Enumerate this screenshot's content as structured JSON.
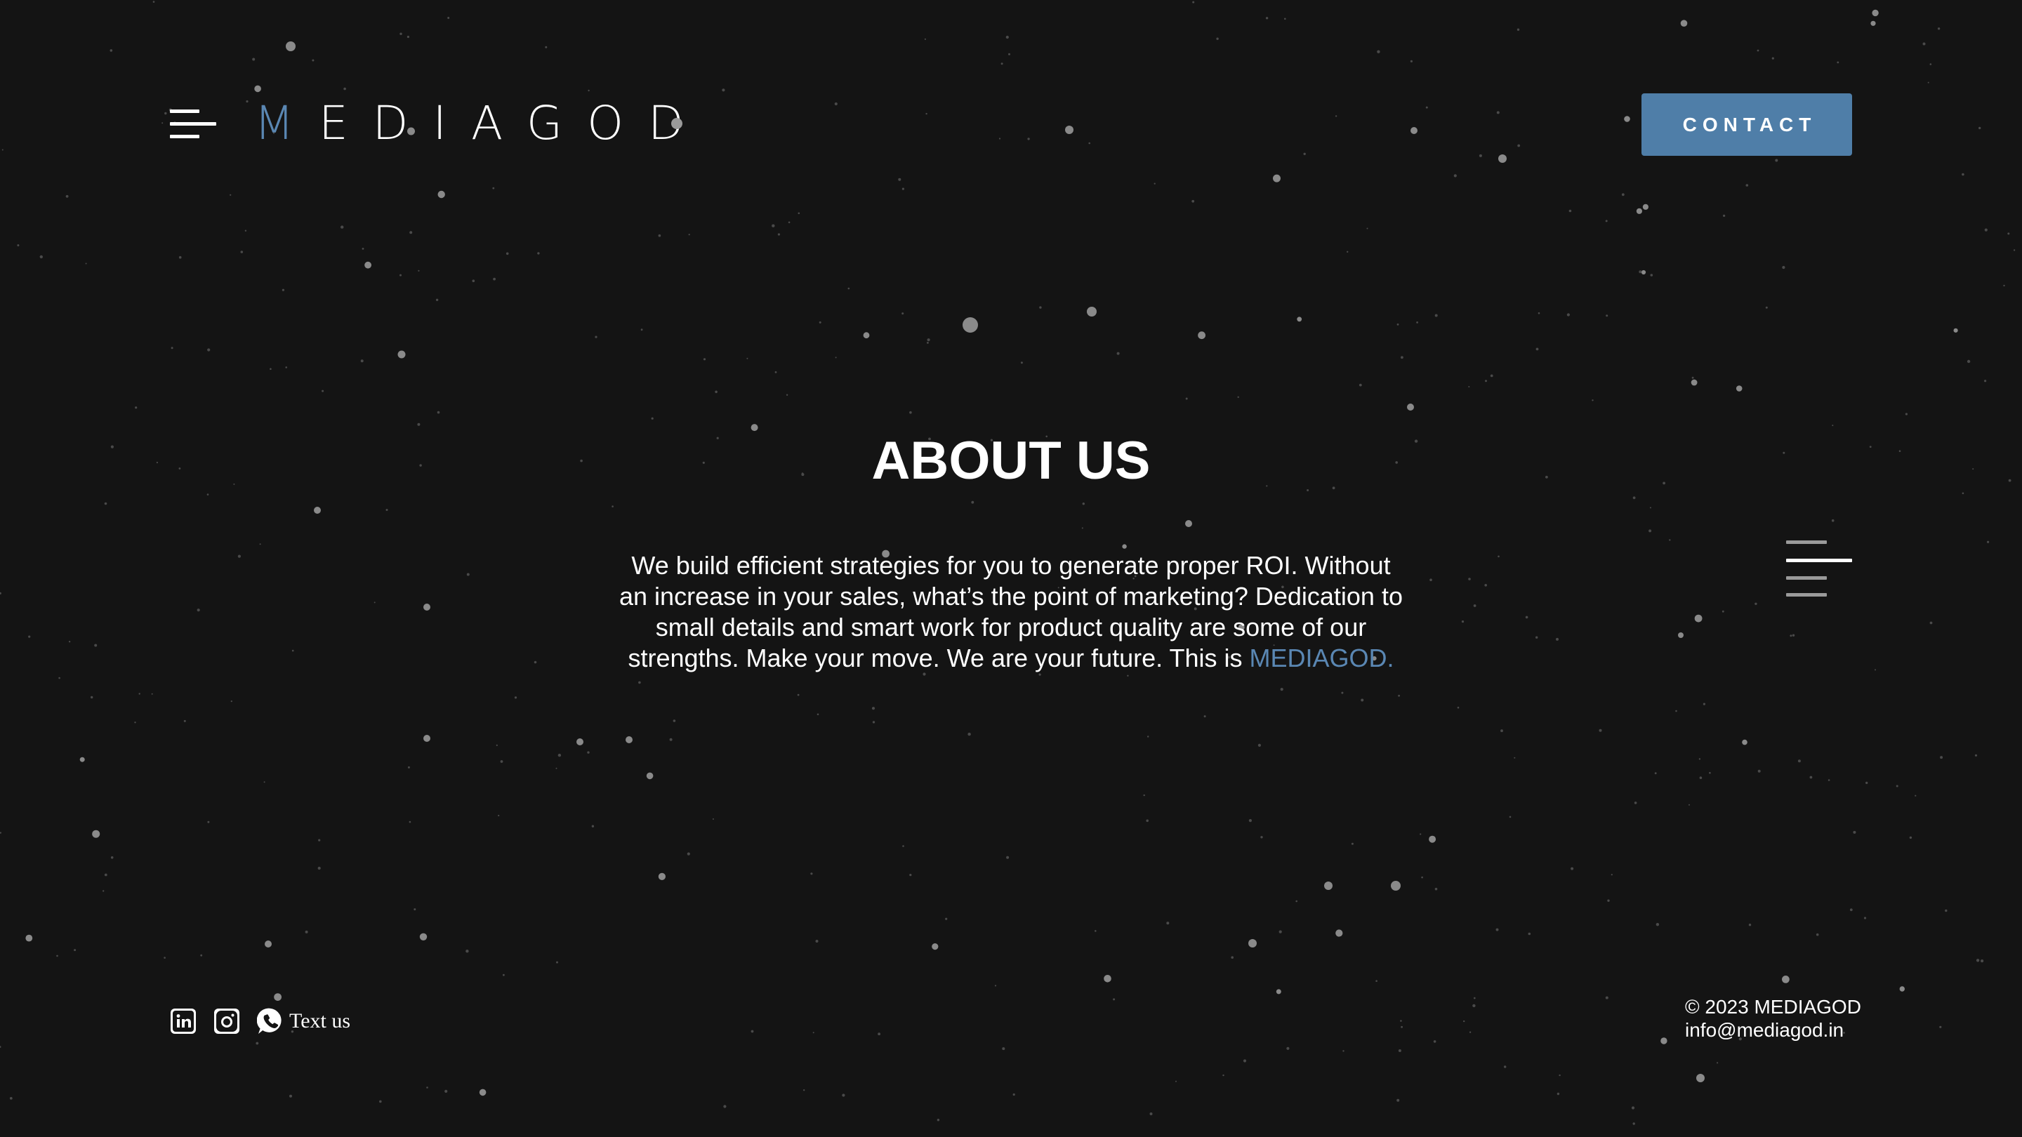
{
  "header": {
    "logo_first_letter": "M",
    "logo_rest": "EDIAGOD",
    "contact_label": "CONTACT"
  },
  "about": {
    "title": "ABOUT US",
    "body": "We build efficient strategies for you to generate proper ROI. Without an increase in your sales, what’s the point of marketing? Dedication to small details and smart work for product quality are some of our strengths. Make your move. We are your future. This is ",
    "brand": "MEDIAGOD."
  },
  "footer": {
    "social": [
      {
        "icon": "linkedin-icon"
      },
      {
        "icon": "instagram-icon"
      },
      {
        "icon": "whatsapp-icon",
        "label": "Text us"
      }
    ],
    "copyright": "© 2023 MEDIAGOD",
    "email": "info@mediagod.in"
  },
  "colors": {
    "background": "#141414",
    "accent": "#5a87b3",
    "button": "#4f7ea8",
    "text": "#ffffff"
  }
}
